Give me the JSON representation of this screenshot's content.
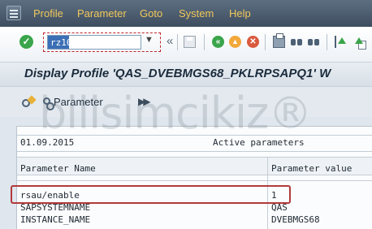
{
  "menubar": {
    "items": [
      "Profile",
      "Parameter",
      "Goto",
      "System",
      "Help"
    ]
  },
  "toolbar": {
    "command_value": "rz10"
  },
  "page_title": "Display Profile 'QAS_DVEBMGS68_PKLRPSAPQ1' W",
  "app_toolbar": {
    "parameter_button": "Parameter"
  },
  "report": {
    "date": "01.09.2015",
    "heading": "Active parameters",
    "columns": [
      "Parameter Name",
      "Parameter value"
    ],
    "rows": [
      {
        "name": "rsau/enable",
        "value": "1"
      },
      {
        "name": "SAPSYSTEMNAME",
        "value": "QAS"
      },
      {
        "name": "INSTANCE_NAME",
        "value": "DVEBMGS68"
      }
    ]
  },
  "watermark": "bilisimcikiz®"
}
